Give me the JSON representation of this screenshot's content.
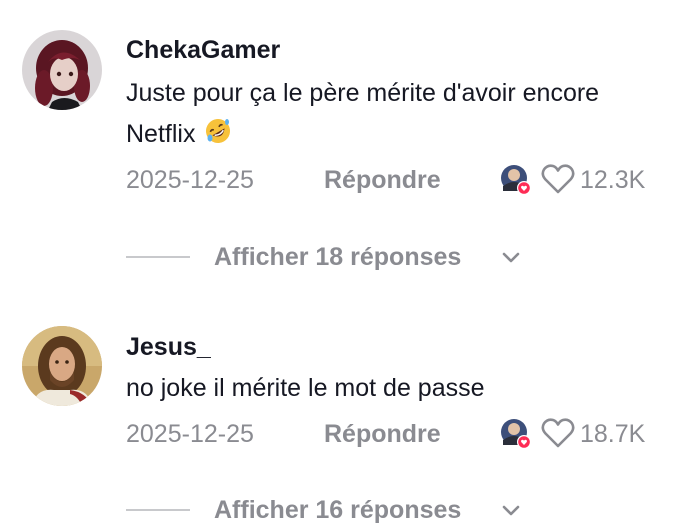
{
  "comments": [
    {
      "username": "ChekaGamer",
      "text": "Juste pour ça le père mérite d'avoir encore Netflix",
      "emoji": "rolling-on-floor-laughing-emoji",
      "date": "2025-12-25",
      "reply_label": "Répondre",
      "likes": "12.3K",
      "liked_by_creator": true,
      "replies_label": "Afficher 18 réponses"
    },
    {
      "username": "Jesus_",
      "text": "no joke il mérite le mot de passe",
      "date": "2025-12-25",
      "reply_label": "Répondre",
      "likes": "18.7K",
      "liked_by_creator": true,
      "replies_label": "Afficher 16 réponses"
    }
  ],
  "colors": {
    "text_primary": "#161823",
    "text_secondary": "#8a8b91",
    "divider": "#c8c9cc",
    "creator_heart_badge": "#fe2c55"
  }
}
